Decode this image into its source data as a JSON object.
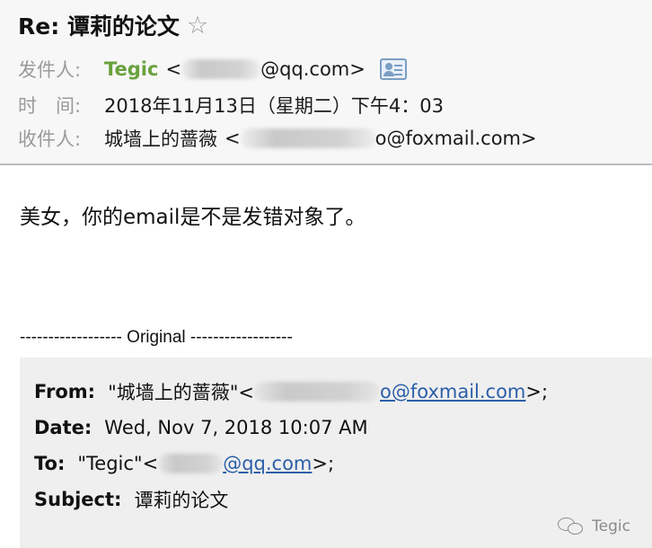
{
  "header": {
    "subject": "Re: 谭莉的论文",
    "from_label": "发件人:",
    "from_name": "Tegic",
    "from_addr_open": "<",
    "from_addr_domain": "@qq.com>",
    "time_label": "时　间:",
    "time_value": "2018年11月13日（星期二）下午4：03",
    "to_label": "收件人:",
    "to_name": "城墙上的蔷薇",
    "to_addr_open": "<",
    "to_addr_domain": "o@foxmail.com>"
  },
  "icons": {
    "star": "☆",
    "contact_card": "contact-card-icon",
    "wechat": "wechat-icon"
  },
  "message": {
    "body": "美女，你的email是不是发错对象了。",
    "separator": "------------------ Original ------------------"
  },
  "quote": {
    "from_label": "From:",
    "from_name": "\"城墙上的蔷薇\"<",
    "from_link": "o@foxmail.com",
    "from_close": ">;",
    "date_label": "Date:",
    "date_value": "Wed, Nov 7, 2018 10:07 AM",
    "to_label": "To:",
    "to_name": "\"Tegic\"<",
    "to_link": "@qq.com",
    "to_close": ">;",
    "subject_label": "Subject:",
    "subject_value": "谭莉的论文"
  },
  "watermark": {
    "text": "Tegic"
  },
  "colors": {
    "sender_green": "#6aa13d",
    "link_blue": "#2b5fa8",
    "label_gray": "#9a9a9a"
  }
}
